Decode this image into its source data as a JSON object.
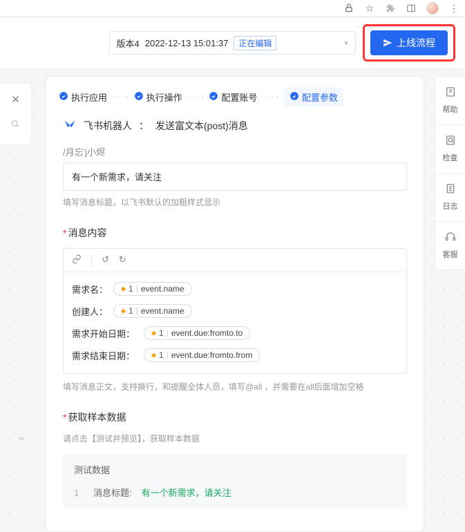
{
  "browser": {
    "icons": [
      "share",
      "star",
      "ext",
      "panel",
      "avatar",
      "menu"
    ]
  },
  "toolbar": {
    "version_prefix": "版本4",
    "version_ts": "2022-12-13 15:01:37",
    "editing_badge": "正在编辑",
    "publish_label": "上线流程"
  },
  "steps": [
    {
      "label": "执行应用",
      "checked": true,
      "active": false
    },
    {
      "label": "执行操作",
      "checked": true,
      "active": false
    },
    {
      "label": "配置账号",
      "checked": true,
      "active": false
    },
    {
      "label": "配置参数",
      "checked": true,
      "active": true
    }
  ],
  "app_row": {
    "name": "飞书机器人",
    "sep": "：",
    "action": "发送富文本(post)消息"
  },
  "title_section": {
    "cut_label": "/月忘'j小烬",
    "value": "有一个新需求，请关注",
    "helper": "填写消息标题，以飞书默认的加粗样式显示"
  },
  "content_section": {
    "label": "消息内容",
    "lines": [
      {
        "label": "需求名：",
        "wide": false,
        "token": {
          "idx": "1",
          "path": "event.name"
        }
      },
      {
        "label": "创建人：",
        "wide": false,
        "token": {
          "idx": "1",
          "path": "event.name"
        }
      },
      {
        "label": "需求开始日期：",
        "wide": true,
        "token": {
          "idx": "1",
          "path": "event.due:fromto.to"
        }
      },
      {
        "label": "需求结束日期：",
        "wide": true,
        "token": {
          "idx": "1",
          "path": "event.due:fromto.from"
        }
      }
    ],
    "helper": "填写消息正文，支持换行，和提醒全体人员，填写@all ，并需要在all后面增加空格"
  },
  "sample_section": {
    "label": "获取样本数据",
    "helper": "请点击【测试并预览】，获取样本数据",
    "test_title": "测试数据",
    "rows": [
      {
        "idx": "1",
        "key": "消息标题:",
        "val": "有一个新需求，请关注"
      }
    ]
  },
  "right_rail": [
    {
      "icon": "help",
      "label": "帮助"
    },
    {
      "icon": "check",
      "label": "检查"
    },
    {
      "icon": "log",
      "label": "日志"
    },
    {
      "icon": "service",
      "label": "客服"
    }
  ]
}
